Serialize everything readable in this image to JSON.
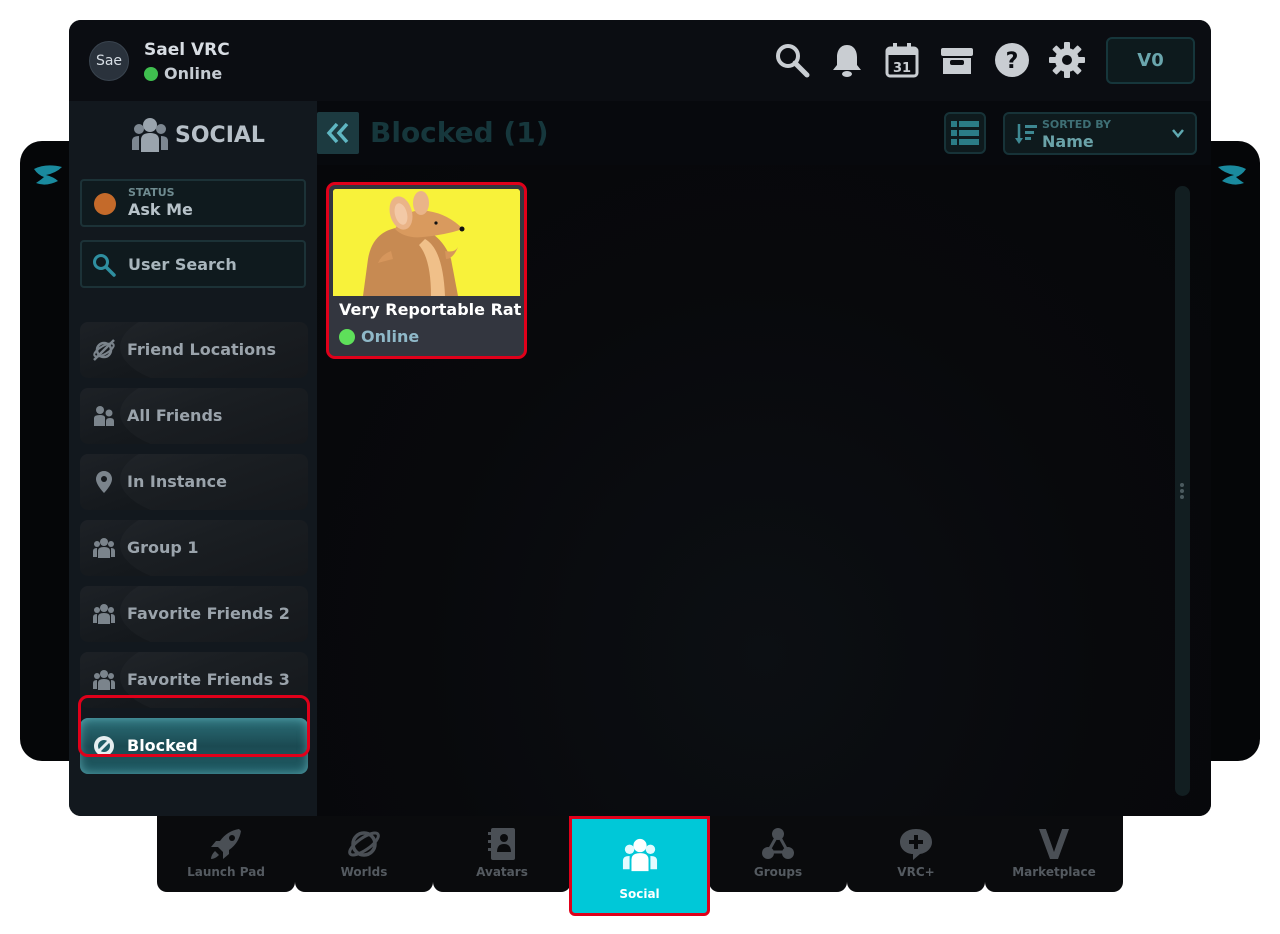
{
  "user": {
    "avatar_text": "Sae",
    "name": "Sael VRC",
    "status": "Online"
  },
  "topbar": {
    "currency_label": "V0"
  },
  "sidebar": {
    "header": "SOCIAL",
    "status": {
      "label": "STATUS",
      "value": "Ask Me",
      "color": "#c46a2a"
    },
    "search_placeholder": "User Search",
    "items": [
      {
        "label": "Friend Locations",
        "icon": "planet-slash-icon"
      },
      {
        "label": "All Friends",
        "icon": "friends-icon"
      },
      {
        "label": "In Instance",
        "icon": "location-pin-icon"
      },
      {
        "label": "Group 1",
        "icon": "group-icon"
      },
      {
        "label": "Favorite Friends 2",
        "icon": "group-icon"
      },
      {
        "label": "Favorite Friends 3",
        "icon": "group-icon"
      },
      {
        "label": "Blocked",
        "icon": "block-icon",
        "active": true
      }
    ]
  },
  "content": {
    "title": "Blocked (1)",
    "sort": {
      "label": "SORTED BY",
      "value": "Name"
    },
    "friends": [
      {
        "name": "Very Reportable Rat",
        "status": "Online"
      }
    ]
  },
  "bottom_nav": {
    "tabs": [
      {
        "label": "Launch Pad",
        "icon": "rocket-icon"
      },
      {
        "label": "Worlds",
        "icon": "planet-icon"
      },
      {
        "label": "Avatars",
        "icon": "avatar-book-icon"
      },
      {
        "label": "Social",
        "icon": "social-people-icon",
        "active": true
      },
      {
        "label": "Groups",
        "icon": "groups-nodes-icon"
      },
      {
        "label": "VRC+",
        "icon": "vrc-plus-icon"
      },
      {
        "label": "Marketplace",
        "icon": "marketplace-v-icon"
      }
    ]
  },
  "colors": {
    "accent": "#00c8d8",
    "highlight": "#e0001a",
    "online": "#5ee05a"
  }
}
